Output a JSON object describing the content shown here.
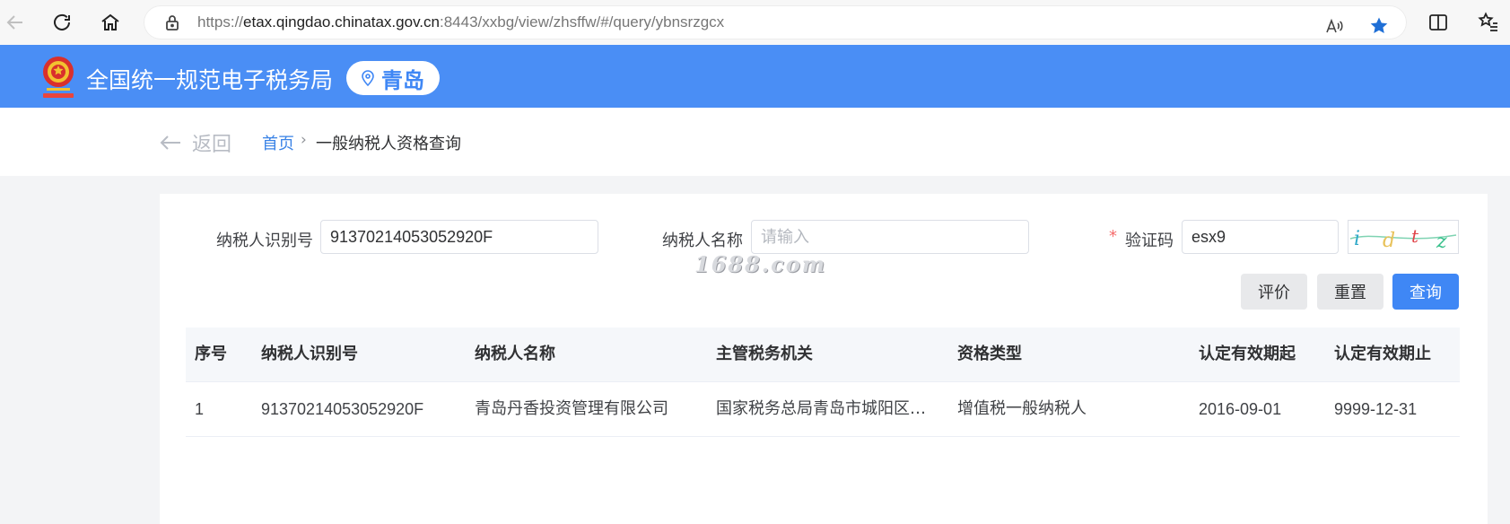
{
  "browser": {
    "url_prefix": "https://",
    "url_host": "etax.qingdao.chinatax.gov.cn",
    "url_rest": ":8443/xxbg/view/zhsffw/#/query/ybnsrzgcx",
    "icons": [
      "back-arrow-icon",
      "refresh-icon",
      "home-icon",
      "lock-icon",
      "read-aloud-icon",
      "favorite-star-icon",
      "split-screen-icon",
      "favorites-list-icon"
    ],
    "accent": "#1f6fd6"
  },
  "header": {
    "title": "全国统一规范电子税务局",
    "region": "青岛",
    "background": "#4a8ef5"
  },
  "breadcrumb": {
    "back_label": "返回",
    "home": "首页",
    "separator": "›",
    "current": "一般纳税人资格查询"
  },
  "form": {
    "taxpayer_id_label": "纳税人识别号",
    "taxpayer_id_value": "91370214053052920F",
    "taxpayer_name_label": "纳税人名称",
    "taxpayer_name_placeholder": "请输入",
    "captcha_label": "验证码",
    "captcha_required_mark": "*",
    "captcha_value": "esx9",
    "captcha_image_text": "idtz"
  },
  "watermark": "1688.com",
  "actions": {
    "evaluate": "评价",
    "reset": "重置",
    "query": "查询",
    "primary_color": "#3f87f5"
  },
  "table": {
    "headers": [
      "序号",
      "纳税人识别号",
      "纳税人名称",
      "主管税务机关",
      "资格类型",
      "认定有效期起",
      "认定有效期止"
    ],
    "rows": [
      [
        "1",
        "91370214053052920F",
        "青岛丹香投资管理有限公司",
        "国家税务总局青岛市城阳区税…",
        "增值税一般纳税人",
        "2016-09-01",
        "9999-12-31"
      ]
    ]
  }
}
